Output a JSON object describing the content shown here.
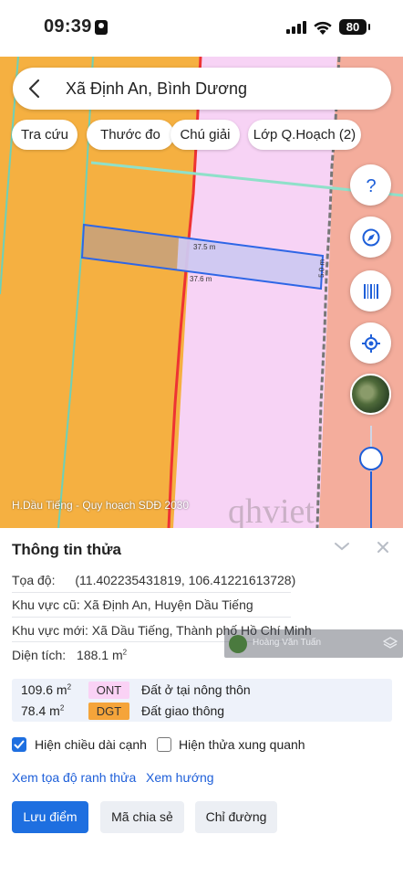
{
  "status_bar": {
    "time": "09:39",
    "battery": "80"
  },
  "search": {
    "title": "Xã Định An, Bình Dương"
  },
  "chips": [
    "Tra cứu",
    "Thước đo",
    "Chú giải",
    "Lớp Q.Hoạch (2)"
  ],
  "map": {
    "layer_label": "H.Dầu Tiếng - Quy hoạch SDĐ 2030",
    "dimensions": [
      "37.5 m",
      "37.6 m",
      "5.0 m"
    ],
    "watermark_text": "qhviet",
    "colors": {
      "orange_zone": "#f5b041",
      "pink_zone": "#f7d3f5",
      "salmon_zone": "#f4ad9c",
      "parcel_outline": "#2e66e6"
    }
  },
  "map_controls": [
    "help-icon",
    "compass-icon",
    "barcode-icon",
    "locate-icon",
    "satellite-icon"
  ],
  "panel": {
    "title": "Thông tin thửa",
    "coords_label": "Tọa độ:",
    "coords_value": "(11.402235431819, 106.41221613728)",
    "old_area_label": "Khu vực cũ:",
    "old_area_value": "Xã Định An, Huyện Dầu Tiếng",
    "new_area_label": "Khu vực mới:",
    "new_area_value": "Xã Dầu Tiếng, Thành phố Hồ Chí Minh",
    "area_label": "Diện tích:",
    "area_value": "188.1 m",
    "area_unit_sup": "2",
    "watermark_name": "Hoàng Văn Tuấn"
  },
  "land_use": [
    {
      "area": "109.6 m",
      "code": "ONT",
      "desc": "Đất ở tại nông thôn",
      "color": "#fad2f5"
    },
    {
      "area": "78.4 m",
      "code": "DGT",
      "desc": "Đất giao thông",
      "color": "#f5a43a"
    }
  ],
  "options": {
    "show_edge_length": {
      "label": "Hiện chiều dài cạnh",
      "checked": true
    },
    "show_neighbors": {
      "label": "Hiện thửa xung quanh",
      "checked": false
    }
  },
  "links": {
    "boundary_coords": "Xem tọa độ ranh thửa",
    "direction": "Xem hướng"
  },
  "buttons": {
    "save": "Lưu điểm",
    "share": "Mã chia sẻ",
    "route": "Chỉ đường"
  }
}
